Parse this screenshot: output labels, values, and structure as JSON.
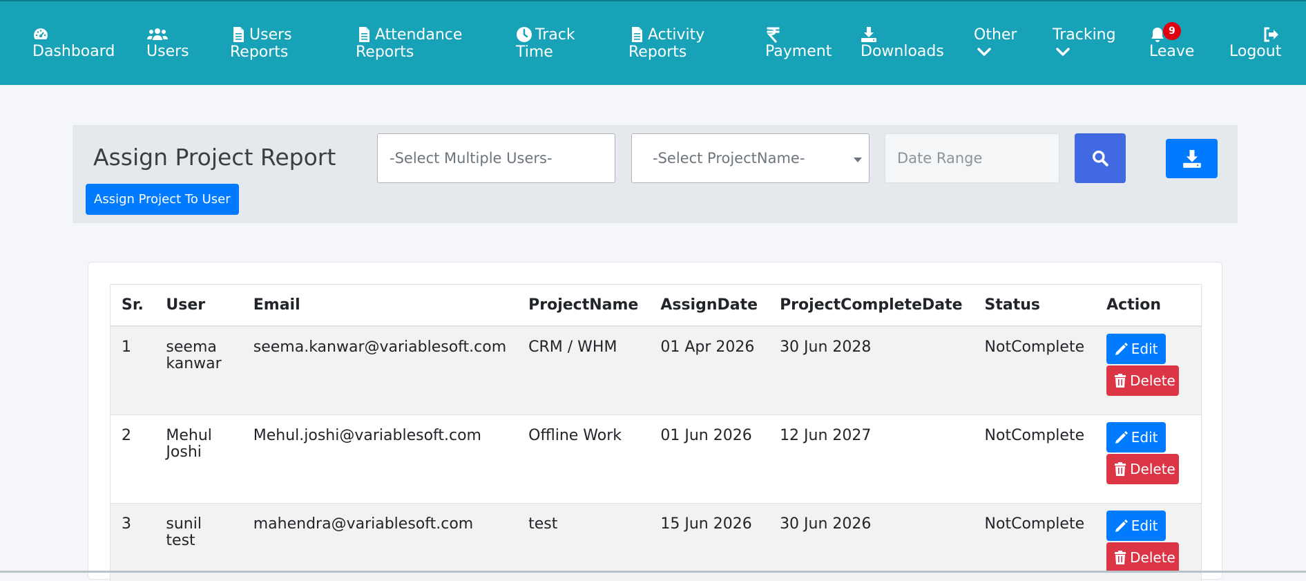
{
  "nav": {
    "items": [
      {
        "icon": "dashboard-icon",
        "line1": "",
        "line2": "Dashboard"
      },
      {
        "icon": "users-icon",
        "line1": "",
        "line2": "Users"
      },
      {
        "icon": "file-icon",
        "line1": "Users",
        "line2": "Reports"
      },
      {
        "icon": "file-icon",
        "line1": "Attendance",
        "line2": "Reports"
      },
      {
        "icon": "clock-icon",
        "line1": "Track",
        "line2": "Time"
      },
      {
        "icon": "file-icon",
        "line1": "Activity",
        "line2": "Reports"
      },
      {
        "icon": "rupee-icon",
        "line1": "",
        "line2": "Payment"
      },
      {
        "icon": "download-icon",
        "line1": "",
        "line2": "Downloads"
      },
      {
        "icon": "chevron-down-icon",
        "line1": "Other",
        "line2": ""
      },
      {
        "icon": "chevron-down-icon",
        "line1": "Tracking",
        "line2": ""
      },
      {
        "icon": "bell-icon",
        "line1": "",
        "line2": "Leave",
        "badge": "9"
      },
      {
        "icon": "logout-icon",
        "line1": "",
        "line2": "Logout"
      }
    ]
  },
  "filters": {
    "title": "Assign Project Report",
    "assign_label": "Assign Project To User",
    "users_placeholder": "-Select Multiple Users-",
    "project_placeholder": "-Select ProjectName-",
    "date_placeholder": "Date Range"
  },
  "table": {
    "headers": [
      "Sr.",
      "User",
      "Email",
      "ProjectName",
      "AssignDate",
      "ProjectCompleteDate",
      "Status",
      "Action"
    ],
    "rows": [
      {
        "sr": "1",
        "user": "seema kanwar",
        "email": "seema.kanwar@variablesoft.com",
        "project": "CRM / WHM",
        "assign": "01 Apr 2026",
        "complete": "30 Jun 2028",
        "status": "NotComplete"
      },
      {
        "sr": "2",
        "user": "Mehul Joshi",
        "email": "Mehul.joshi@variablesoft.com",
        "project": "Offline Work",
        "assign": "01 Jun 2026",
        "complete": "12 Jun 2027",
        "status": "NotComplete"
      },
      {
        "sr": "3",
        "user": "sunil test",
        "email": "mahendra@variablesoft.com",
        "project": "test",
        "assign": "15 Jun 2026",
        "complete": "30 Jun 2026",
        "status": "NotComplete"
      }
    ],
    "edit_label": "Edit",
    "delete_label": "Delete"
  },
  "colors": {
    "navbar": "#17a2b8",
    "primary": "#007bff",
    "danger": "#dc3545",
    "search": "#4169e1",
    "badge": "#e0000f"
  }
}
